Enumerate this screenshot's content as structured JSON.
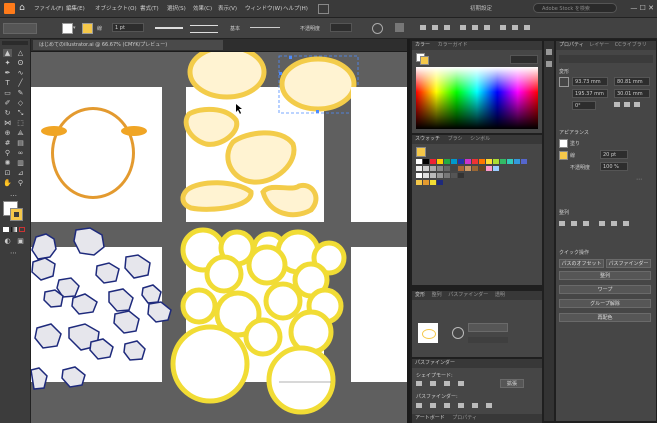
{
  "app": {
    "logo_text": "Ai"
  },
  "menu": {
    "items": [
      "ファイル(F)",
      "編集(E)",
      "オブジェクト(O)",
      "書式(T)",
      "選択(S)",
      "効果(C)",
      "表示(V)",
      "ウィンドウ(W)",
      "ヘルプ(H)"
    ],
    "right_label": "初期設定",
    "search_placeholder": "Adobe Stock を検索"
  },
  "control_bar": {
    "stroke_label": "線",
    "stroke_width": "1 pt",
    "brush_label": "基本",
    "opacity_label": "不透明度"
  },
  "document": {
    "tab_title": "はじめてのillustrator.ai @ 66.67% (CMYK/プレビュー)"
  },
  "panels": {
    "top_tabs": [
      "カラー",
      "カラーガイド"
    ],
    "swatch_tabs": [
      "スウォッチ",
      "ブラシ",
      "シンボル"
    ],
    "properties_tabs": [
      "プロパティ",
      "レイヤー",
      "CCライブラリ"
    ],
    "transform": {
      "heading": "変形",
      "x": "93.73 mm",
      "y": "195.37 mm",
      "w": "80.81 mm",
      "h": "30.01 mm",
      "angle": "0°"
    },
    "appearance": {
      "heading": "アピアランス",
      "fill_label": "塗り",
      "stroke_label": "線",
      "stroke_value": "20 pt",
      "opacity_label": "不透明度",
      "opacity_value": "100 %"
    },
    "align_heading": "整列",
    "quick_actions": {
      "heading": "クイック操作",
      "buttons": [
        "パスのオフセット",
        "パスファインダー",
        "整列",
        "ワープ",
        "グループ解除",
        "再配色"
      ]
    },
    "lower_tabs": [
      "変形",
      "整列",
      "パスファインダー",
      "透明"
    ],
    "pathfinder": {
      "heading": "パスファインダー",
      "shape_modes": "シェイプモード:",
      "pathfinders": "パスファインダー:",
      "expand": "拡張"
    },
    "bottom_tabs": [
      "アートボード",
      "プロパティ"
    ]
  },
  "colors": {
    "orange": "#e39a2f",
    "yellow": "#f1dc35",
    "navy": "#1e2a7c",
    "chip": "#e6e6ec",
    "accent": "#f5c84a"
  }
}
